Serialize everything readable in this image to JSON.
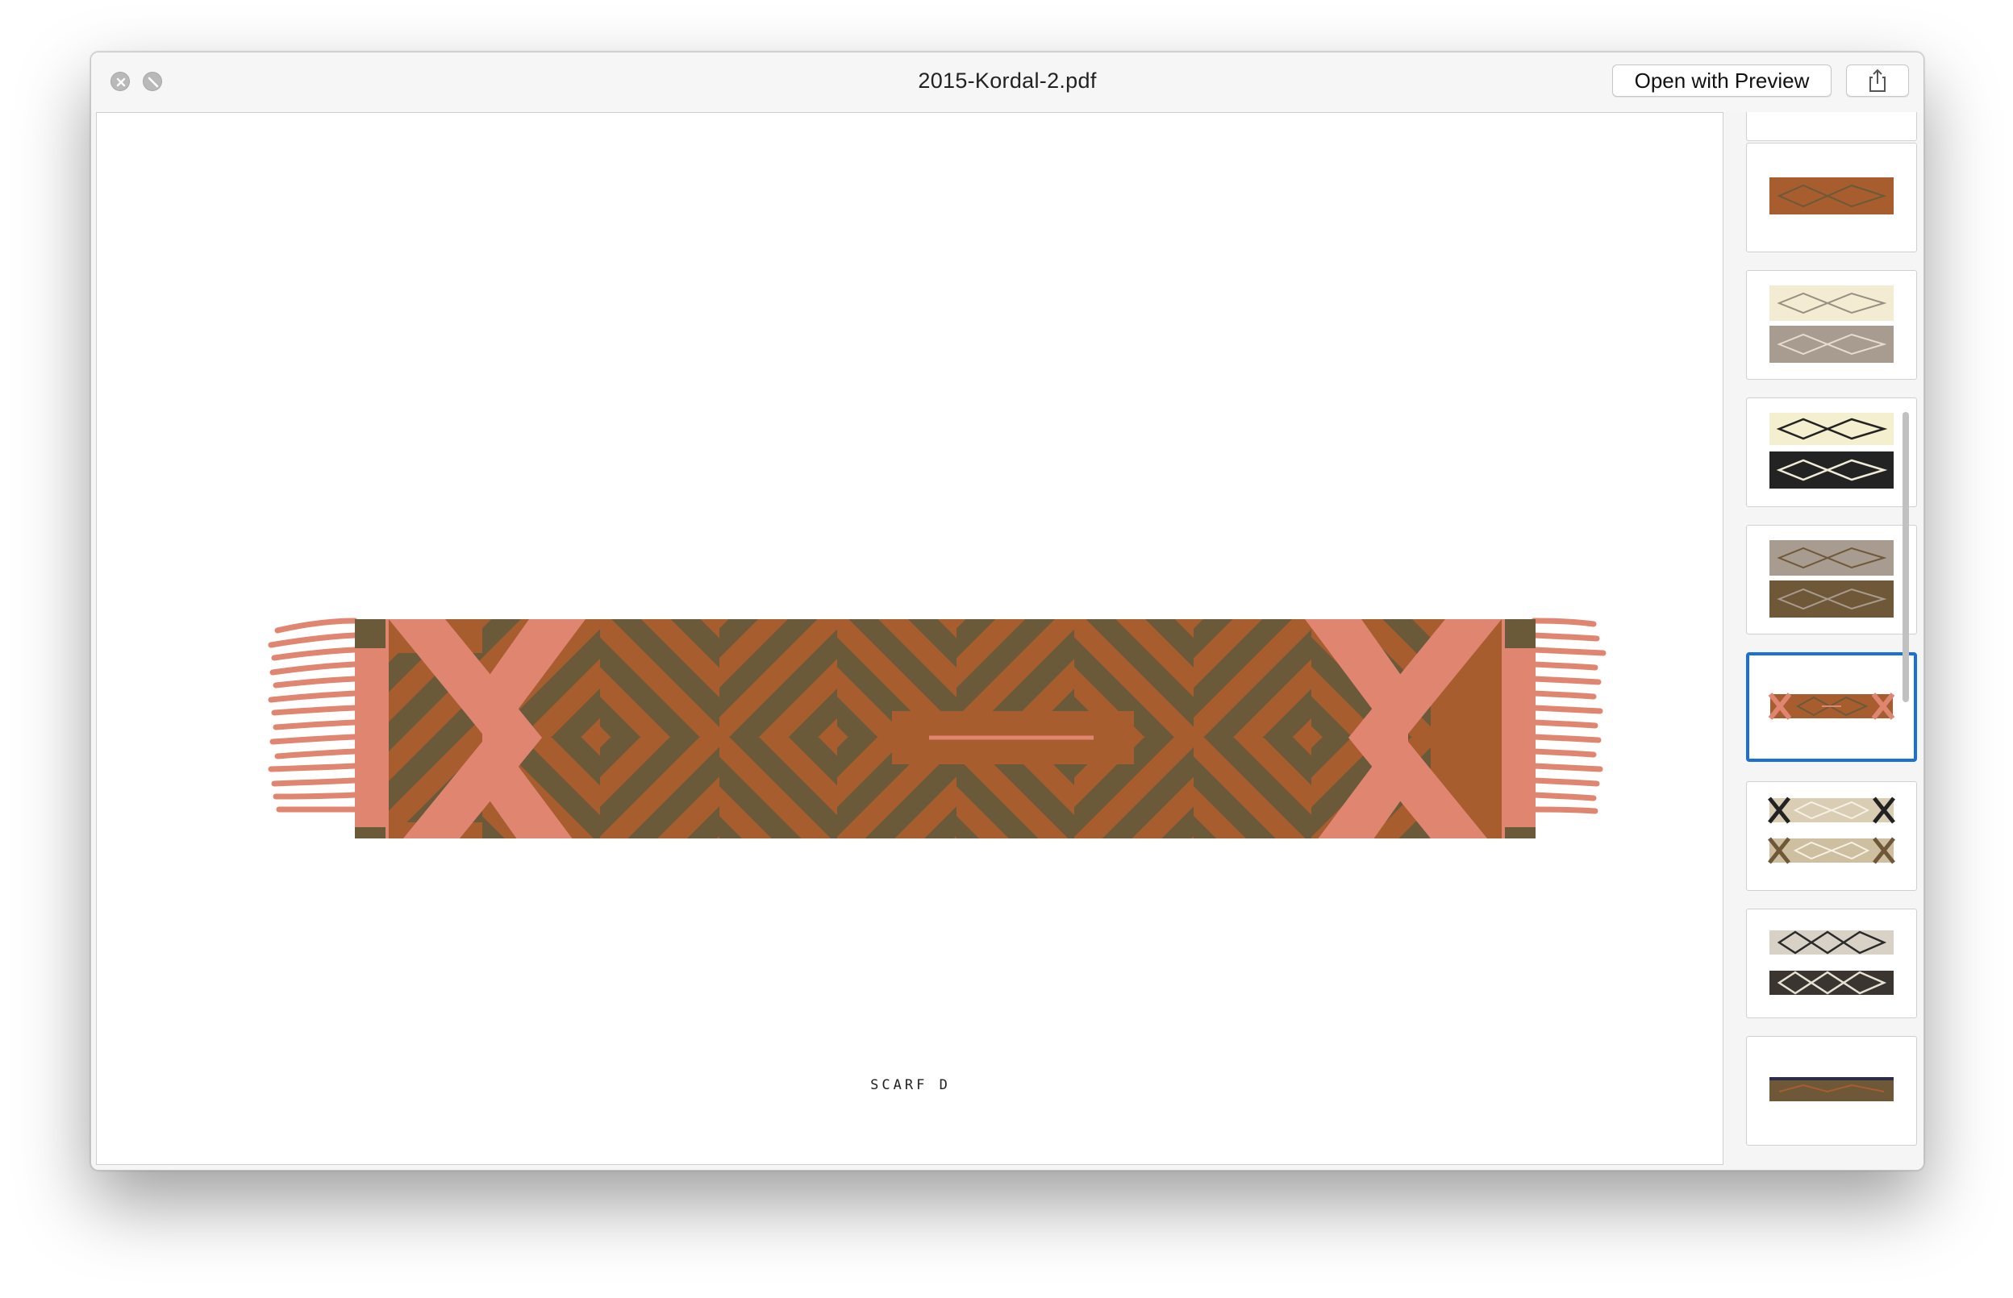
{
  "window": {
    "title": "2015-Kordal-2.pdf",
    "open_with_label": "Open with Preview",
    "controls": {
      "close_icon": "close-icon",
      "fullscreen_icon": "fullscreen-icon",
      "share_icon": "share-icon"
    }
  },
  "document": {
    "caption": "SCARF D",
    "colors": {
      "rust": "#a85d2e",
      "olive": "#6b5a3a",
      "salmon": "#e08570"
    }
  },
  "sidebar": {
    "selected_index": 5,
    "thumbnails": [
      {
        "index": 0,
        "style": "partial"
      },
      {
        "index": 1,
        "style": "rust-single"
      },
      {
        "index": 2,
        "style": "cream-taupe"
      },
      {
        "index": 3,
        "style": "cream-black"
      },
      {
        "index": 4,
        "style": "taupe-brown"
      },
      {
        "index": 5,
        "style": "rust-salmon"
      },
      {
        "index": 6,
        "style": "black-beige-pair"
      },
      {
        "index": 7,
        "style": "grey-black-pair"
      },
      {
        "index": 8,
        "style": "brown-single"
      }
    ]
  }
}
